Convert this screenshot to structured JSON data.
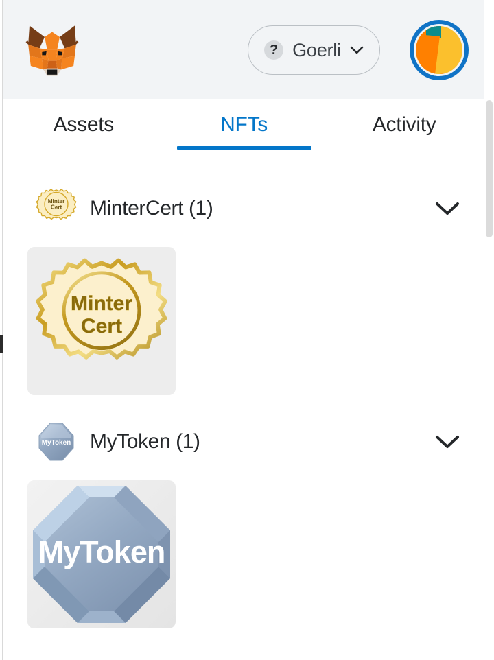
{
  "app": {
    "name": "MetaMask",
    "accent_color": "#0376c9",
    "header_bg": "#f2f4f6"
  },
  "header": {
    "logo_name": "metamask-fox-logo",
    "network": {
      "label": "Goerli",
      "icon": "question-mark-icon",
      "chevron": "chevron-down-icon"
    },
    "avatar_name": "account-identicon",
    "menu_icon": "hamburger-menu-icon"
  },
  "tabs": [
    {
      "id": "assets",
      "label": "Assets",
      "active": false
    },
    {
      "id": "nfts",
      "label": "NFTs",
      "active": true
    },
    {
      "id": "activity",
      "label": "Activity",
      "active": false
    }
  ],
  "collections": [
    {
      "id": "mintercert",
      "title": "MinterCert (1)",
      "name": "MinterCert",
      "count": 1,
      "icon": "minter-cert-seal-icon",
      "chevron": "chevron-down-icon",
      "items": [
        {
          "id": "mintercert-1",
          "alt": "Minter Cert seal badge",
          "line1": "Minter",
          "line2": "Cert",
          "art": "gold-seal"
        }
      ]
    },
    {
      "id": "mytoken",
      "title": "MyToken (1)",
      "name": "MyToken",
      "count": 1,
      "icon": "mytoken-octagon-icon",
      "chevron": "chevron-down-icon",
      "items": [
        {
          "id": "mytoken-1",
          "alt": "MyToken beveled octagon",
          "line1": "MyToken",
          "line2": "",
          "art": "blue-octagon"
        }
      ]
    }
  ]
}
